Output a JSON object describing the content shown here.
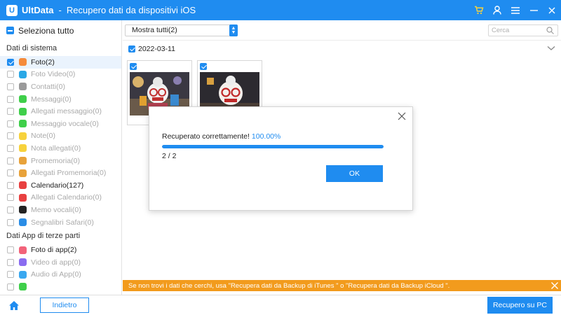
{
  "title_bar": {
    "logo_letter": "U",
    "app_name": "UltData",
    "separator": "-",
    "window_title": "Recupero dati da dispositivi iOS",
    "icons": [
      "cart-icon",
      "user-icon",
      "menu-icon",
      "minimize-icon",
      "close-icon"
    ],
    "cart_color": "#f7d23c"
  },
  "sidebar": {
    "select_all_label": "Seleziona tutto",
    "groups": [
      {
        "title": "Dati di sistema",
        "items": [
          {
            "label": "Foto(2)",
            "checked": true,
            "enabled": true,
            "active": true,
            "icon": "photos-icon",
            "icon_color": "#f58b3b"
          },
          {
            "label": "Foto Video(0)",
            "checked": false,
            "enabled": false,
            "active": false,
            "icon": "photo-video-icon",
            "icon_color": "#2aa8e6"
          },
          {
            "label": "Contatti(0)",
            "checked": false,
            "enabled": false,
            "active": false,
            "icon": "contacts-icon",
            "icon_color": "#9a9a9a"
          },
          {
            "label": "Messaggi(0)",
            "checked": false,
            "enabled": false,
            "active": false,
            "icon": "messages-icon",
            "icon_color": "#3fcf4a"
          },
          {
            "label": "Allegati messaggio(0)",
            "checked": false,
            "enabled": false,
            "active": false,
            "icon": "message-attachments-icon",
            "icon_color": "#3fcf4a"
          },
          {
            "label": "Messaggio vocale(0)",
            "checked": false,
            "enabled": false,
            "active": false,
            "icon": "voicemail-icon",
            "icon_color": "#3fcf4a"
          },
          {
            "label": "Note(0)",
            "checked": false,
            "enabled": false,
            "active": false,
            "icon": "notes-icon",
            "icon_color": "#f7d23c"
          },
          {
            "label": "Nota allegati(0)",
            "checked": false,
            "enabled": false,
            "active": false,
            "icon": "note-attachments-icon",
            "icon_color": "#f7d23c"
          },
          {
            "label": "Promemoria(0)",
            "checked": false,
            "enabled": false,
            "active": false,
            "icon": "reminders-icon",
            "icon_color": "#e8a23a"
          },
          {
            "label": "Allegati Promemoria(0)",
            "checked": false,
            "enabled": false,
            "active": false,
            "icon": "reminder-attachments-icon",
            "icon_color": "#e8a23a"
          },
          {
            "label": "Calendario(127)",
            "checked": false,
            "enabled": true,
            "active": false,
            "icon": "calendar-icon",
            "icon_color": "#e84040"
          },
          {
            "label": "Allegati Calendario(0)",
            "checked": false,
            "enabled": false,
            "active": false,
            "icon": "calendar-attachments-icon",
            "icon_color": "#e84040"
          },
          {
            "label": "Memo vocali(0)",
            "checked": false,
            "enabled": false,
            "active": false,
            "icon": "voice-memos-icon",
            "icon_color": "#222222"
          },
          {
            "label": "Segnalibri Safari(0)",
            "checked": false,
            "enabled": false,
            "active": false,
            "icon": "safari-icon",
            "icon_color": "#2a8de6"
          }
        ]
      },
      {
        "title": "Dati App di terze parti",
        "items": [
          {
            "label": "Foto di app(2)",
            "checked": false,
            "enabled": true,
            "active": false,
            "icon": "app-photos-icon",
            "icon_color": "#f2637a"
          },
          {
            "label": "Video di app(0)",
            "checked": false,
            "enabled": false,
            "active": false,
            "icon": "app-videos-icon",
            "icon_color": "#8a6cf0"
          },
          {
            "label": "Audio di App(0)",
            "checked": false,
            "enabled": false,
            "active": false,
            "icon": "app-audio-icon",
            "icon_color": "#3aa8f0"
          },
          {
            "label": "",
            "checked": false,
            "enabled": false,
            "active": false,
            "icon": "app-docs-icon",
            "icon_color": "#3fcf4a"
          }
        ]
      }
    ]
  },
  "toolbar": {
    "filter_value": "Mostra tutti(2)",
    "search_placeholder": "Cerca"
  },
  "date_group": {
    "date": "2022-03-11",
    "checked": true
  },
  "photos": [
    {
      "checked": true,
      "name": "photo-1"
    },
    {
      "checked": true,
      "name": "photo-2"
    }
  ],
  "dialog": {
    "status_text": "Recuperato correttamente!",
    "percent_text": "100.00%",
    "progress": 1.0,
    "count_text": "2 / 2",
    "ok_label": "OK"
  },
  "notice": {
    "text": "Se non trovi i dati che cerchi, usa \"Recupera dati da Backup di iTunes \" o \"Recupera dati da Backup iCloud \"."
  },
  "footer": {
    "back_label": "Indietro",
    "recover_label": "Recupero su PC"
  },
  "colors": {
    "accent": "#1f8cf0",
    "notice_bg": "#f29b1d",
    "disabled_text": "#aaaaaa"
  }
}
